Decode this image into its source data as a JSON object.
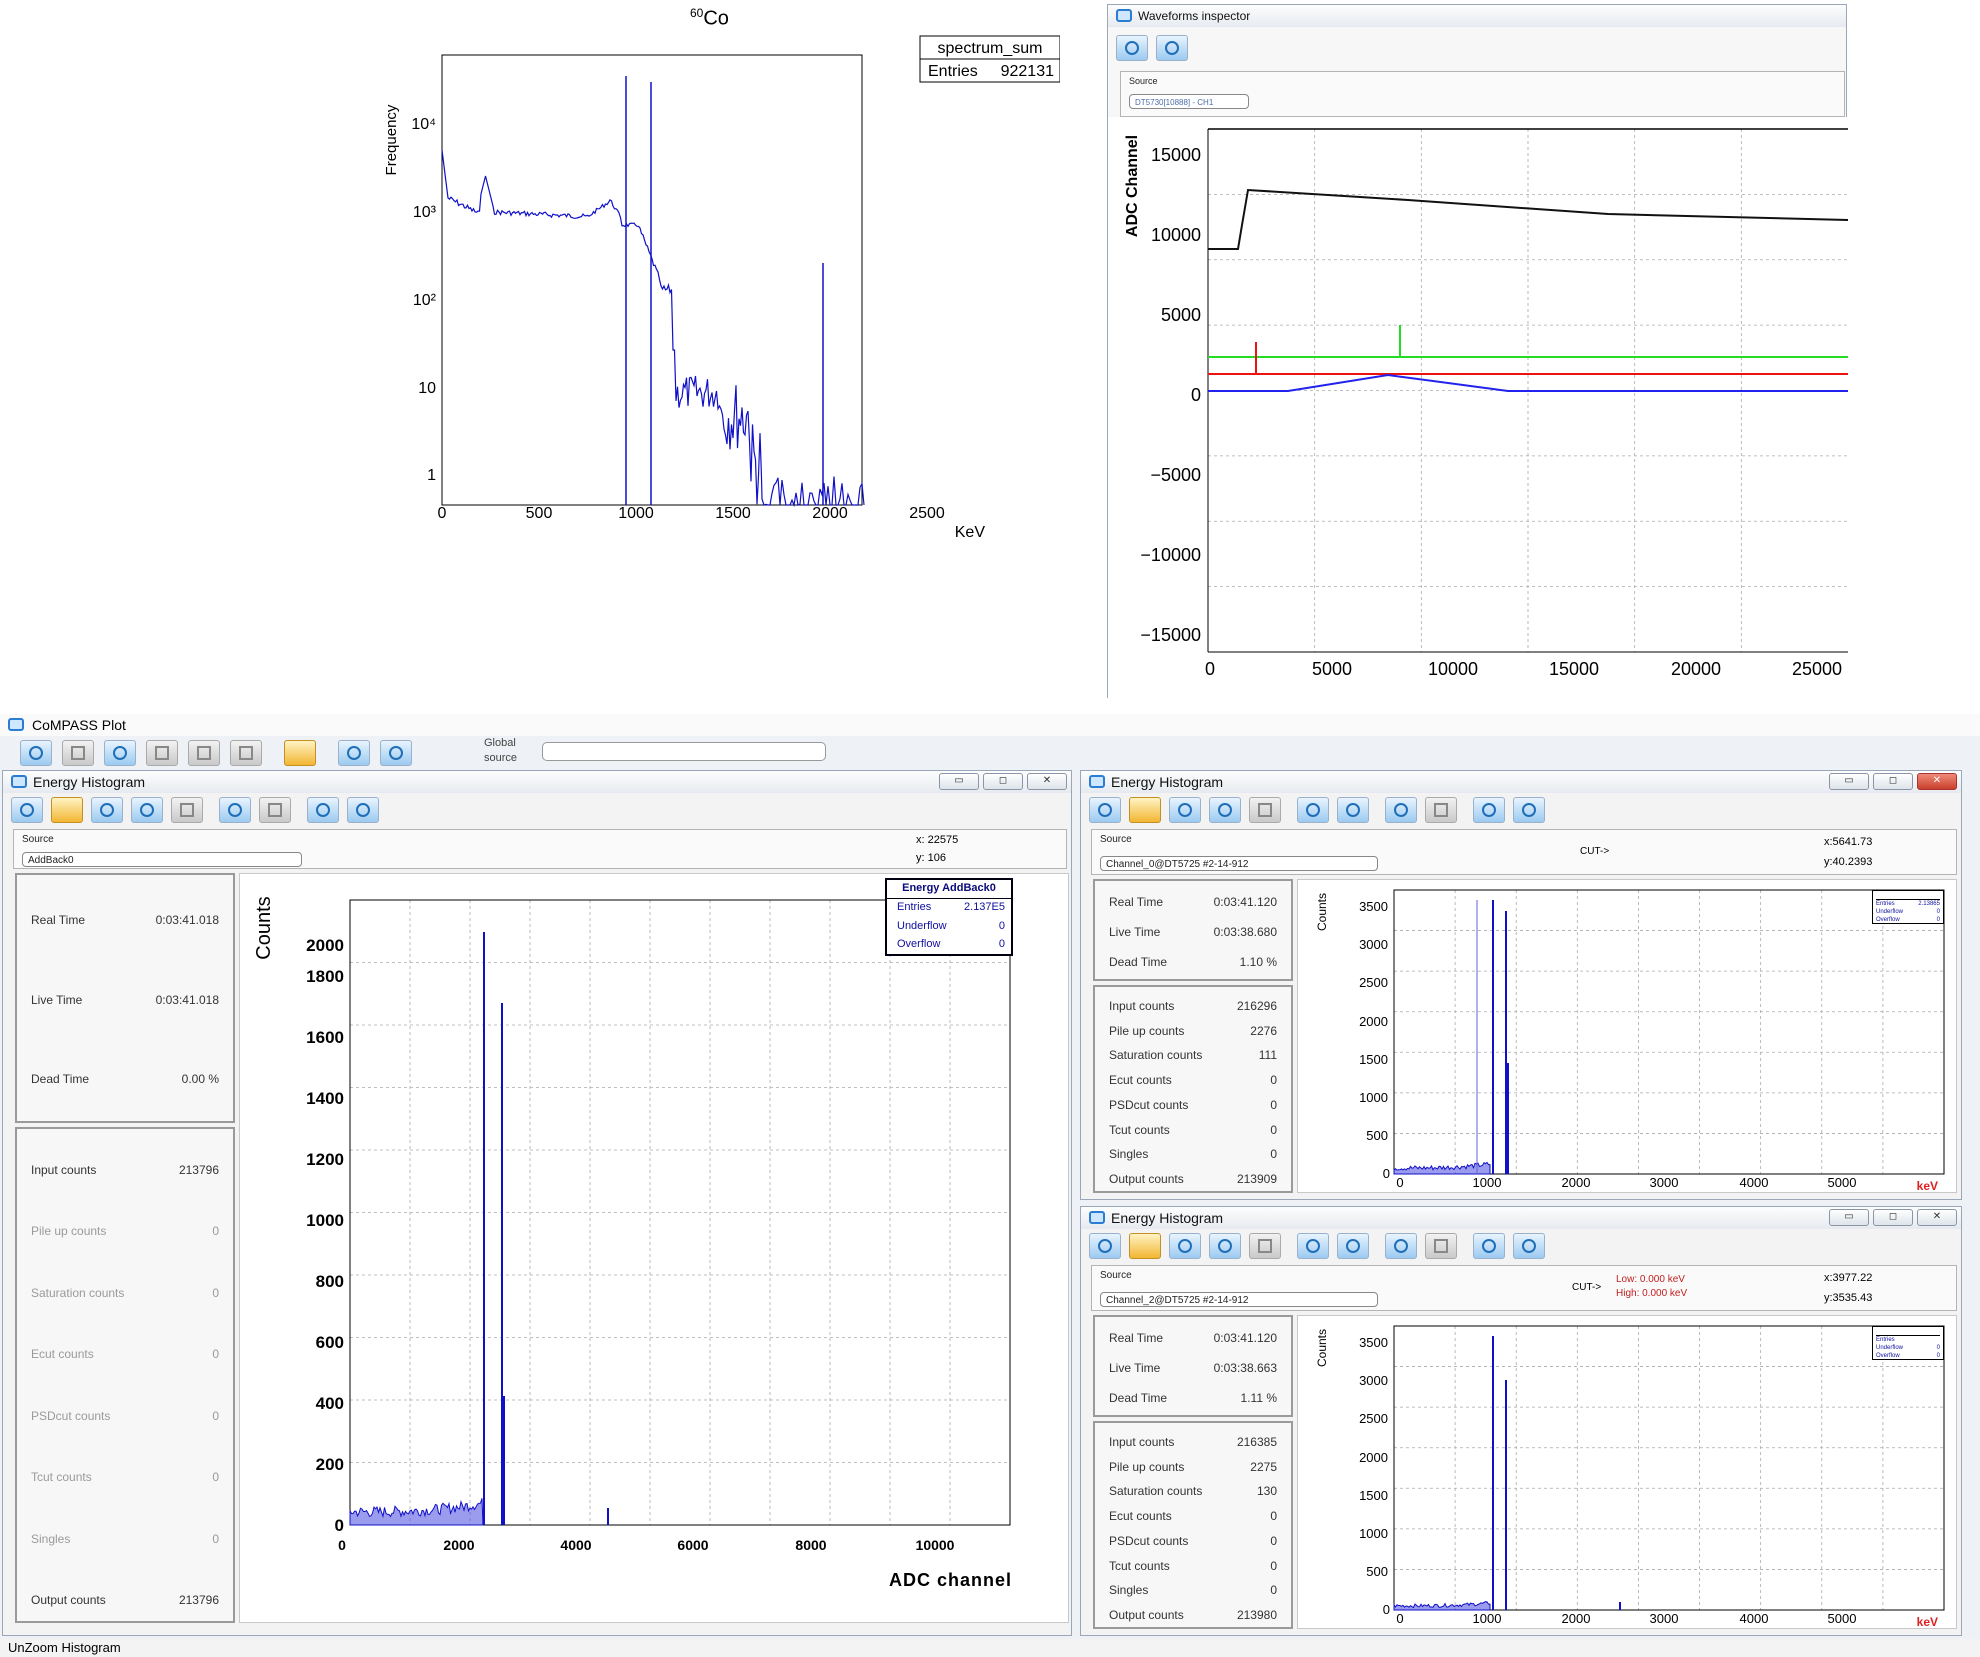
{
  "top_left_plot": {
    "title_sup": "60",
    "title_main": "Co",
    "stats_name": "spectrum_sum",
    "stats_entries_label": "Entries",
    "stats_entries_value": "922131",
    "ylabel": "Frequency",
    "xlabel": "KeV",
    "xticks": [
      "0",
      "500",
      "1000",
      "1500",
      "2000",
      "2500"
    ],
    "yticks": [
      "1",
      "10",
      "10²",
      "10³",
      "10⁴"
    ]
  },
  "waveforms": {
    "title": "Waveforms inspector",
    "source_label": "Source",
    "source_value": "DT5730[10888] - CH1",
    "ylabel": "ADC Channel",
    "yticks": [
      "15000",
      "10000",
      "5000",
      "0",
      "−5000",
      "−10000",
      "−15000"
    ],
    "xticks": [
      "0",
      "5000",
      "10000",
      "15000",
      "20000",
      "25000"
    ]
  },
  "compass": {
    "title": "CoMPASS Plot",
    "global_source_label": "Global source",
    "global_source_value": "",
    "status_text": "UnZoom Histogram"
  },
  "main_hist": {
    "title": "Energy Histogram",
    "source_label": "Source",
    "source_value": "AddBack0",
    "cursor_x": "x: 22575",
    "cursor_y": "y: 106",
    "stats_title": "Energy AddBack0",
    "stats_rows": [
      {
        "label": "Entries",
        "value": "2.137E5"
      },
      {
        "label": "Underflow",
        "value": "0"
      },
      {
        "label": "Overflow",
        "value": "0"
      }
    ],
    "times": [
      {
        "label": "Real Time",
        "value": "0:03:41.018"
      },
      {
        "label": "Live Time",
        "value": "0:03:41.018"
      },
      {
        "label": "Dead Time",
        "value": "0.00 %"
      }
    ],
    "counts": [
      {
        "label": "Input counts",
        "value": "213796"
      },
      {
        "label": "Pile up counts",
        "value": "0"
      },
      {
        "label": "Saturation counts",
        "value": "0"
      },
      {
        "label": "Ecut counts",
        "value": "0"
      },
      {
        "label": "PSDcut counts",
        "value": "0"
      },
      {
        "label": "Tcut counts",
        "value": "0"
      },
      {
        "label": "Singles",
        "value": "0"
      },
      {
        "label": "Output counts",
        "value": "213796"
      }
    ],
    "ylabel": "Counts",
    "xlabel": "ADC channel",
    "yticks": [
      "0",
      "200",
      "400",
      "600",
      "800",
      "1000",
      "1200",
      "1400",
      "1600",
      "1800",
      "2000"
    ],
    "xticks": [
      "0",
      "2000",
      "4000",
      "6000",
      "8000",
      "10000"
    ]
  },
  "ch0_hist": {
    "title": "Energy Histogram",
    "source_label": "Source",
    "source_value": "Channel_0@DT5725 #2-14-912",
    "cut_label": "CUT->",
    "cursor_x": "x:5641.73",
    "cursor_y": "y:40.2393",
    "times": [
      {
        "label": "Real Time",
        "value": "0:03:41.120"
      },
      {
        "label": "Live Time",
        "value": "0:03:38.680"
      },
      {
        "label": "Dead Time",
        "value": "1.10 %"
      }
    ],
    "counts": [
      {
        "label": "Input counts",
        "value": "216296"
      },
      {
        "label": "Pile up counts",
        "value": "2276"
      },
      {
        "label": "Saturation counts",
        "value": "111"
      },
      {
        "label": "Ecut counts",
        "value": "0"
      },
      {
        "label": "PSDcut counts",
        "value": "0"
      },
      {
        "label": "Tcut counts",
        "value": "0"
      },
      {
        "label": "Singles",
        "value": "0"
      },
      {
        "label": "Output counts",
        "value": "213909"
      }
    ],
    "stats_rows": [
      {
        "label": "Entries",
        "value": "2.13865"
      },
      {
        "label": "Underflow",
        "value": "0"
      },
      {
        "label": "Overflow",
        "value": "0"
      }
    ],
    "ylabel": "Counts",
    "xlabel": "keV",
    "yticks": [
      "0",
      "500",
      "1000",
      "1500",
      "2000",
      "2500",
      "3000",
      "3500"
    ],
    "xticks": [
      "0",
      "1000",
      "2000",
      "3000",
      "4000",
      "5000"
    ]
  },
  "ch2_hist": {
    "title": "Energy Histogram",
    "source_label": "Source",
    "source_value": "Channel_2@DT5725 #2-14-912",
    "cut_label": "CUT->",
    "cut_low": "Low: 0.000 keV",
    "cut_high": "High: 0.000 keV",
    "cursor_x": "x:3977.22",
    "cursor_y": "y:3535.43",
    "times": [
      {
        "label": "Real Time",
        "value": "0:03:41.120"
      },
      {
        "label": "Live Time",
        "value": "0:03:38.663"
      },
      {
        "label": "Dead Time",
        "value": "1.11 %"
      }
    ],
    "counts": [
      {
        "label": "Input counts",
        "value": "216385"
      },
      {
        "label": "Pile up counts",
        "value": "2275"
      },
      {
        "label": "Saturation counts",
        "value": "130"
      },
      {
        "label": "Ecut counts",
        "value": "0"
      },
      {
        "label": "PSDcut counts",
        "value": "0"
      },
      {
        "label": "Tcut counts",
        "value": "0"
      },
      {
        "label": "Singles",
        "value": "0"
      },
      {
        "label": "Output counts",
        "value": "213980"
      }
    ],
    "stats_rows": [
      {
        "label": "Entries",
        "value": ""
      },
      {
        "label": "Underflow",
        "value": "0"
      },
      {
        "label": "Overflow",
        "value": "0"
      }
    ],
    "ylabel": "Counts",
    "xlabel": "keV",
    "yticks": [
      "0",
      "500",
      "1000",
      "1500",
      "2000",
      "2500",
      "3000",
      "3500"
    ],
    "xticks": [
      "0",
      "1000",
      "2000",
      "3000",
      "4000",
      "5000"
    ]
  },
  "colors": {
    "hist_blue": "#1010c8",
    "wave_black": "#111111",
    "wave_green": "#22dd22",
    "wave_red": "#ee1111",
    "wave_blue": "#2222ee",
    "xlabel_red": "#e02020"
  }
}
